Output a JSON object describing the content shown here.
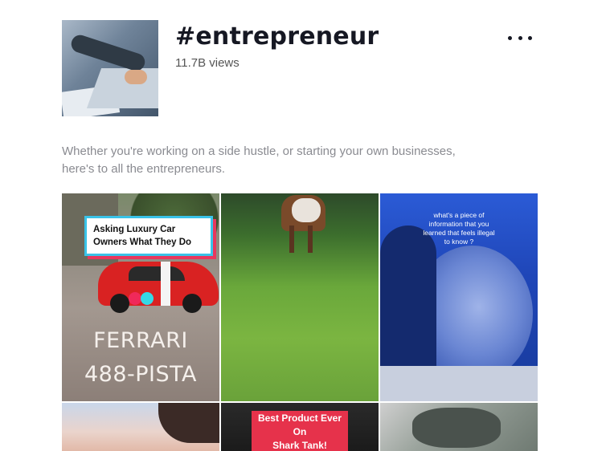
{
  "tag": {
    "title": "#entrepreneur",
    "views": "11.7B views",
    "description_line1": "Whether you're working on a side hustle, or starting your own businesses,",
    "description_line2": "here's to all the entrepreneurs."
  },
  "videos": [
    {
      "caption_line1": "Asking Luxury Car",
      "caption_line2": "Owners What They Do",
      "overlay_line1": "FERRARI",
      "overlay_line2": "488-PISTA"
    },
    {
      "caption": ""
    },
    {
      "caption": "what's a piece of information that you learned that feels illegal to know ?"
    },
    {
      "caption": ""
    },
    {
      "caption_line1": "Best Product Ever On",
      "caption_line2": "Shark Tank!"
    },
    {
      "caption": ""
    }
  ],
  "icons": {
    "more": "more-horizontal-icon"
  }
}
